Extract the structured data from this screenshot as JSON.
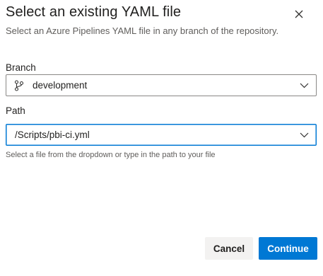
{
  "dialog": {
    "title": "Select an existing YAML file",
    "subtitle": "Select an Azure Pipelines YAML file in any branch of the repository.",
    "close_icon": "close-icon"
  },
  "branch": {
    "label": "Branch",
    "value": "development",
    "icon": "branch-icon"
  },
  "path": {
    "label": "Path",
    "value": "/Scripts/pbi-ci.yml",
    "helper": "Select a file from the dropdown or type in the path to your file"
  },
  "actions": {
    "cancel_label": "Cancel",
    "continue_label": "Continue"
  },
  "colors": {
    "accent": "#0078d4",
    "text": "#201f1e",
    "secondary_text": "#605e5c",
    "cancel_bg": "#f3f2f1"
  }
}
